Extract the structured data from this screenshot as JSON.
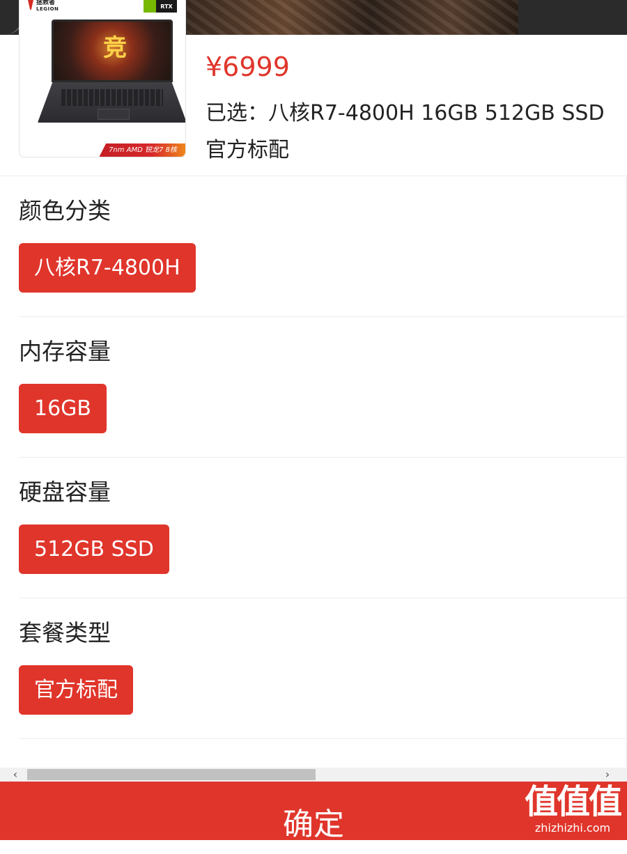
{
  "product": {
    "brand_cn": "拯救者",
    "brand_en": "LEGION",
    "gpu_badge": "RTX",
    "screen_glyph": "竞",
    "promo": "7nm AMD 锐龙7 8核",
    "price": "¥6999",
    "selected_text": "已选：八核R7-4800H 16GB 512GB SSD 官方标配"
  },
  "option_groups": [
    {
      "title": "颜色分类",
      "option": "八核R7-4800H"
    },
    {
      "title": "内存容量",
      "option": "16GB"
    },
    {
      "title": "硬盘容量",
      "option": "512GB SSD"
    },
    {
      "title": "套餐类型",
      "option": "官方标配"
    }
  ],
  "scrollbar": {
    "left_arrow": "‹",
    "right_arrow": "›"
  },
  "confirm": {
    "label": "确定"
  },
  "watermark": {
    "main": "值值值",
    "sub": "zhizhizhi.com"
  },
  "colors": {
    "accent": "#e0352b",
    "text": "#222222"
  }
}
